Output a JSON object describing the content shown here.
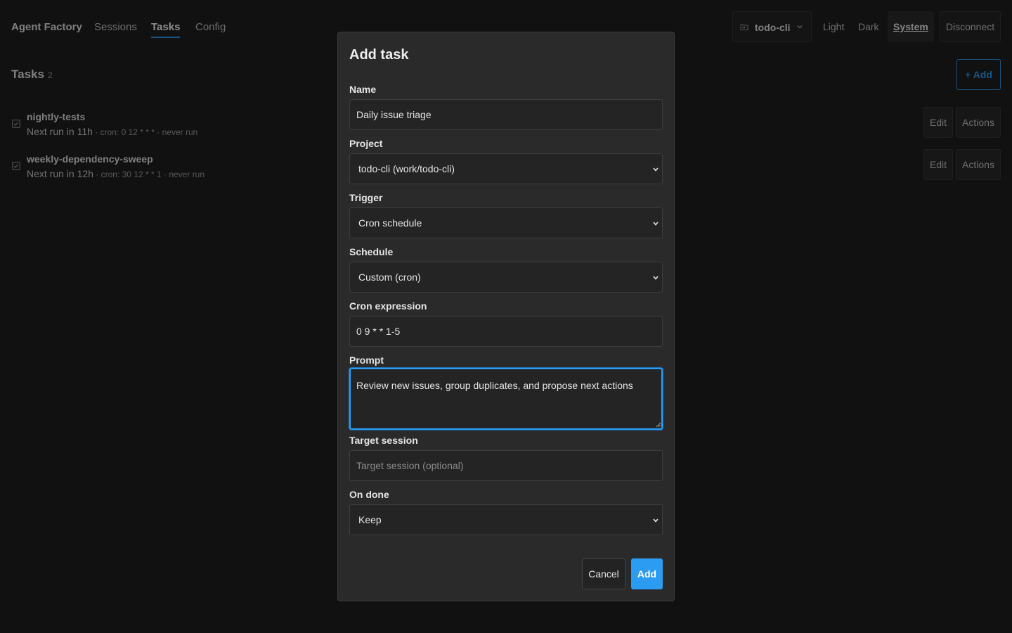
{
  "nav": {
    "brand": "Agent Factory",
    "sessions": "Sessions",
    "tasks": "Tasks",
    "config": "Config"
  },
  "header": {
    "project_label": "todo-cli",
    "project_icon": "folder-icon",
    "theme_light": "Light",
    "theme_dark": "Dark",
    "theme_system": "System",
    "disconnect": "Disconnect"
  },
  "tasks_page": {
    "title": "Tasks",
    "count": "2",
    "add_label": "+ Add",
    "edit_label": "Edit",
    "actions_label": "Actions",
    "items": [
      {
        "name": "nightly-tests",
        "next_run": "Next run in 11h",
        "details": " · cron: 0 12 * * * · never run"
      },
      {
        "name": "weekly-dependency-sweep",
        "next_run": "Next run in 12h",
        "details": " · cron: 30 12 * * 1 · never run"
      }
    ]
  },
  "dialog": {
    "title": "Add task",
    "name_label": "Name",
    "name_value": "Daily issue triage",
    "project_label": "Project",
    "project_value": "todo-cli (work/todo-cli)",
    "trigger_label": "Trigger",
    "trigger_value": "Cron schedule",
    "schedule_label": "Schedule",
    "schedule_value": "Custom (cron)",
    "cron_label": "Cron expression",
    "cron_value": "0 9 * * 1-5",
    "prompt_label": "Prompt",
    "prompt_value": "Review new issues, group duplicates, and propose next actions",
    "target_label": "Target session",
    "target_placeholder": "Target session (optional)",
    "ondone_label": "On done",
    "ondone_value": "Keep",
    "cancel": "Cancel",
    "add": "Add"
  },
  "colors": {
    "accent": "#2b9cf2",
    "background": "#1f1f1f",
    "dialog": "#2a2a2a"
  }
}
